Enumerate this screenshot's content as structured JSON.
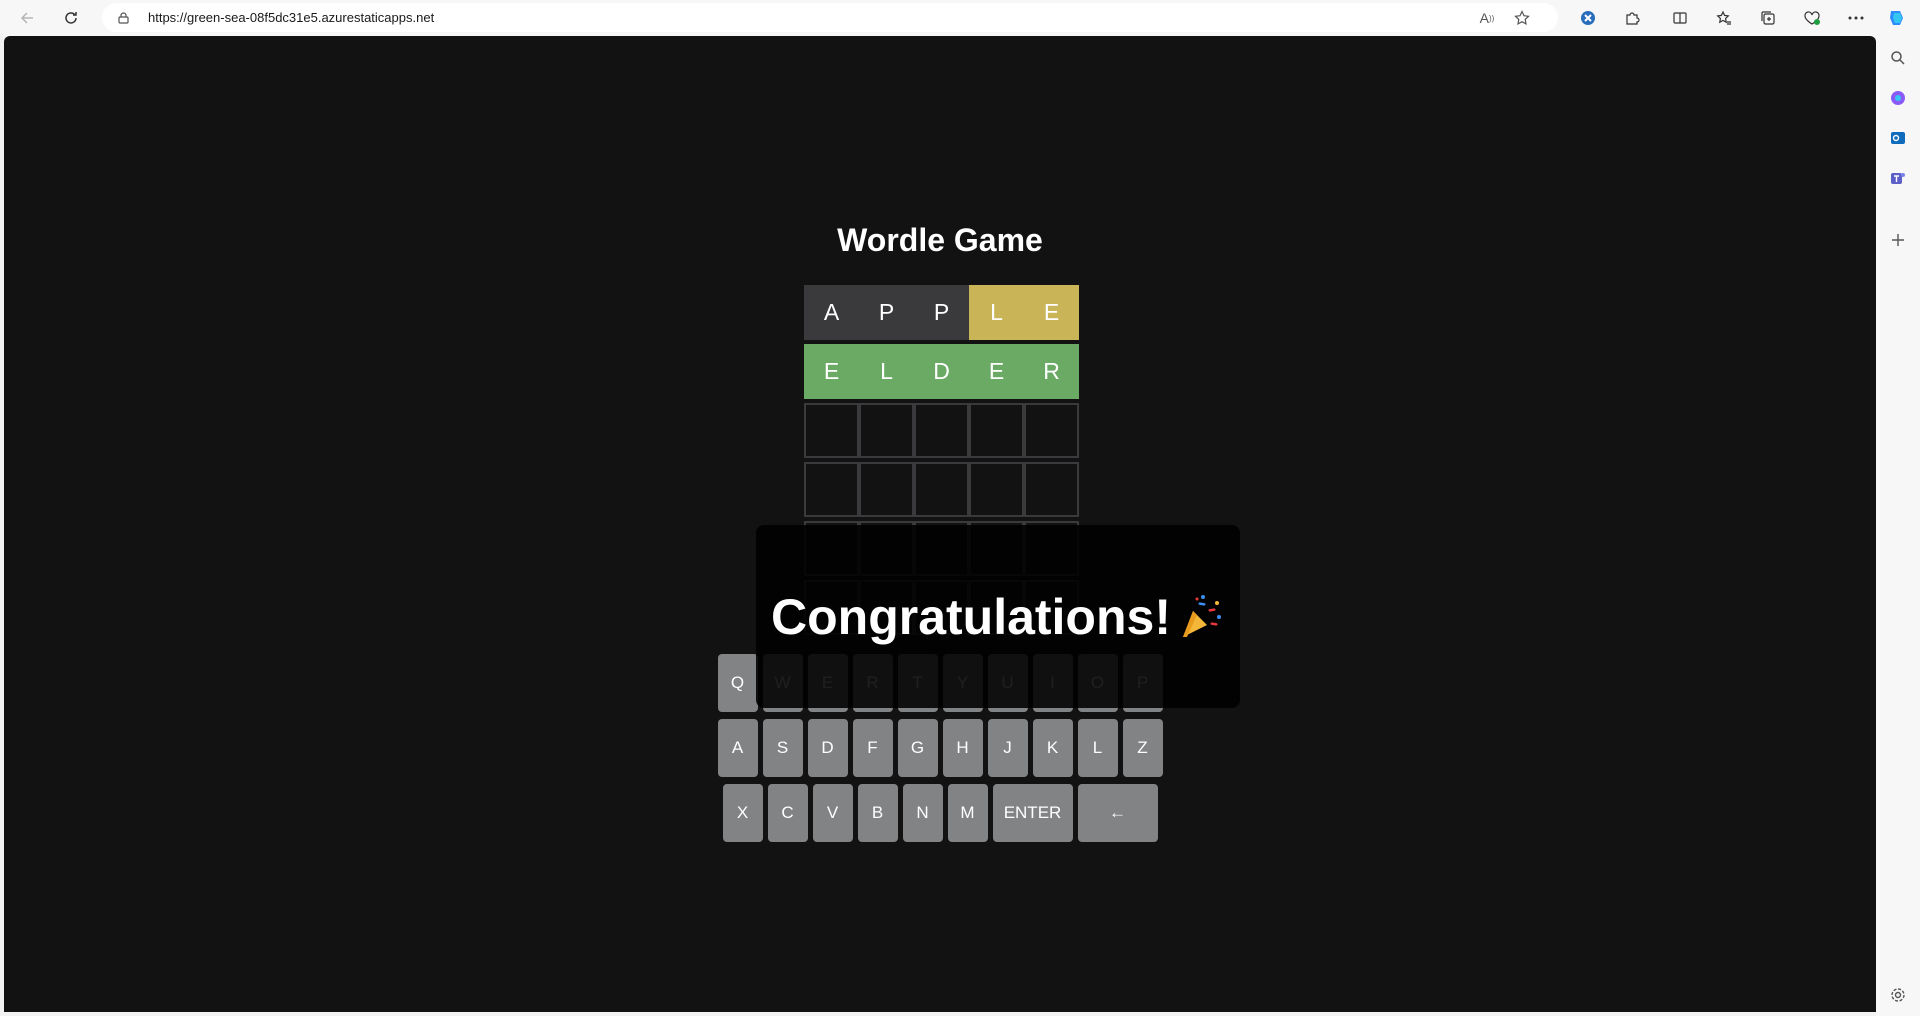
{
  "browser": {
    "url": "https://green-sea-08f5dc31e5.azurestaticapps.net",
    "icons": [
      "back-icon",
      "refresh-icon",
      "lock-icon",
      "read-aloud-icon",
      "favorite-star-icon",
      "extension-icon",
      "puzzle-icon",
      "split-screen-icon",
      "favorites-icon",
      "collections-icon",
      "performance-icon",
      "more-icon"
    ],
    "sidebar_icons": [
      "copilot-icon",
      "search-icon",
      "shapes-icon",
      "outlook-icon",
      "teams-icon",
      "add-icon",
      "settings-icon"
    ]
  },
  "game": {
    "title": "Wordle Game",
    "board": [
      [
        {
          "l": "A",
          "s": "absent"
        },
        {
          "l": "P",
          "s": "absent"
        },
        {
          "l": "P",
          "s": "absent"
        },
        {
          "l": "L",
          "s": "present"
        },
        {
          "l": "E",
          "s": "present"
        }
      ],
      [
        {
          "l": "E",
          "s": "correct"
        },
        {
          "l": "L",
          "s": "correct"
        },
        {
          "l": "D",
          "s": "correct"
        },
        {
          "l": "E",
          "s": "correct"
        },
        {
          "l": "R",
          "s": "correct"
        }
      ],
      [
        {
          "l": "",
          "s": "empty"
        },
        {
          "l": "",
          "s": "empty"
        },
        {
          "l": "",
          "s": "empty"
        },
        {
          "l": "",
          "s": "empty"
        },
        {
          "l": "",
          "s": "empty"
        }
      ],
      [
        {
          "l": "",
          "s": "empty"
        },
        {
          "l": "",
          "s": "empty"
        },
        {
          "l": "",
          "s": "empty"
        },
        {
          "l": "",
          "s": "empty"
        },
        {
          "l": "",
          "s": "empty"
        }
      ],
      [
        {
          "l": "",
          "s": "empty"
        },
        {
          "l": "",
          "s": "empty"
        },
        {
          "l": "",
          "s": "empty"
        },
        {
          "l": "",
          "s": "empty"
        },
        {
          "l": "",
          "s": "empty"
        }
      ],
      [
        {
          "l": "",
          "s": "empty"
        },
        {
          "l": "",
          "s": "empty"
        },
        {
          "l": "",
          "s": "empty"
        },
        {
          "l": "",
          "s": "empty"
        },
        {
          "l": "",
          "s": "empty"
        }
      ]
    ],
    "keyboard": [
      [
        "Q",
        "W",
        "E",
        "R",
        "T",
        "Y",
        "U",
        "I",
        "O",
        "P"
      ],
      [
        "A",
        "S",
        "D",
        "F",
        "G",
        "H",
        "J",
        "K",
        "L",
        "Z"
      ],
      [
        "X",
        "C",
        "V",
        "B",
        "N",
        "M",
        "ENTER",
        "←"
      ]
    ],
    "message": "Congratulations!",
    "message_emoji": "party-popper-icon"
  },
  "colors": {
    "background": "#121213",
    "absent": "#3a3a3c",
    "present": "#c9b458",
    "correct": "#6aaa64",
    "key": "#818384"
  }
}
